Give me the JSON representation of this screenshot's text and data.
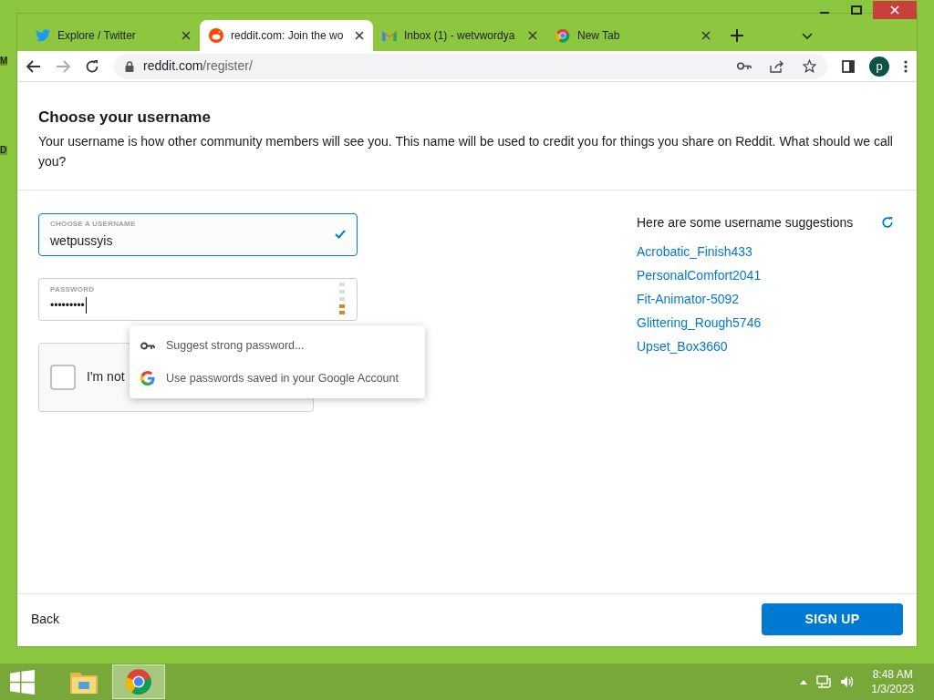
{
  "desktop_labels": [
    "M",
    "D"
  ],
  "browser": {
    "tabs": [
      {
        "kind": "bird",
        "title": "Explore / Twitter",
        "selected": false
      },
      {
        "kind": "alien",
        "title": "reddit.com: Join the wo",
        "selected": true
      },
      {
        "kind": "mail",
        "title": "Inbox (1) - wetvwordya",
        "selected": false
      },
      {
        "kind": "chrome",
        "title": "New Tab",
        "selected": false
      }
    ],
    "address": {
      "host": "reddit.com",
      "path": "/register/"
    },
    "profile": "p"
  },
  "page": {
    "title": "Choose your username",
    "description": "Your username is how other community members will see you. This name will be used to credit you for things you share on Reddit. What should we call you?",
    "username": {
      "label": "CHOOSE A USERNAME",
      "value": "wetpussyis",
      "valid": true
    },
    "password": {
      "label": "PASSWORD",
      "value": "•••••••••"
    },
    "recaptcha": {
      "label": "I'm not",
      "checked": false
    },
    "suggestions": {
      "heading": "Here are some username suggestions",
      "items": [
        "Acrobatic_Finish433",
        "PersonalComfort2041",
        "Fit-Animator-5092",
        "Glittering_Rough5746",
        "Upset_Box3660"
      ]
    },
    "autofill_menu": [
      {
        "kind": "key",
        "label": "Suggest strong password..."
      },
      {
        "kind": "google",
        "label": "Use passwords saved in your Google Account"
      }
    ],
    "back": "Back",
    "signup": "SIGN UP"
  },
  "taskbar": {
    "apps": [
      {
        "kind": "folder",
        "selected": false
      },
      {
        "kind": "chrome",
        "selected": true
      }
    ],
    "time": "8:48 AM",
    "date": "1/3/2023"
  }
}
